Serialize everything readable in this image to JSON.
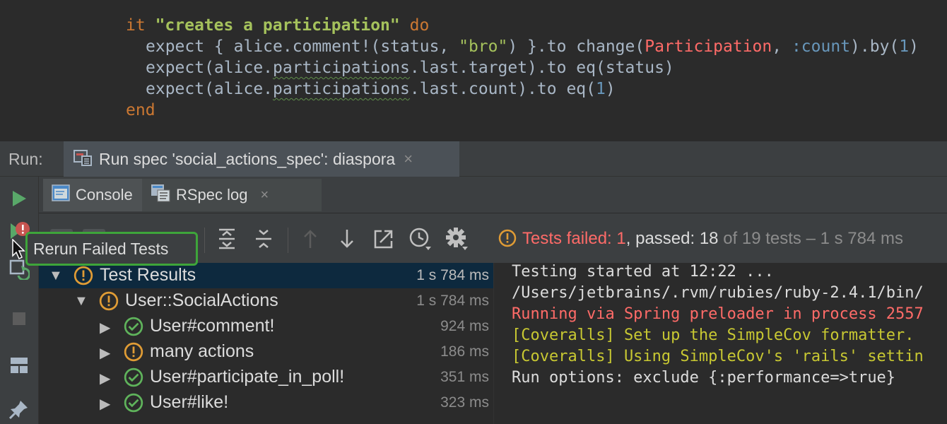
{
  "editor": {
    "line1": {
      "kw_it": "it",
      "string": "\"creates a participation\"",
      "kw_do": "do"
    },
    "line2": {
      "a": "expect { alice.comment!(status, ",
      "str": "\"bro\"",
      "b": ") }.to change(",
      "cls": "Participation",
      "comma": ", ",
      "sym": ":count",
      "c": ").by(",
      "num": "1",
      "d": ")"
    },
    "line3": {
      "a": "expect(alice.",
      "wavy": "participations",
      "b": ".last.target).to eq(status)"
    },
    "line4": {
      "a": "expect(alice.",
      "wavy": "participations",
      "b": ".last.count).to eq(",
      "num": "1",
      "c": ")"
    },
    "line5": {
      "kw_end": "end"
    }
  },
  "run_window": {
    "label": "Run:",
    "tab_label": "Run spec 'social_actions_spec': diaspora",
    "tab_close": "×"
  },
  "sub_tabs": {
    "console": "Console",
    "rspec_log": "RSpec log",
    "close": "×"
  },
  "status": {
    "failed_text": "Tests failed: ",
    "failed_count": "1",
    "passed_text": ", passed: ",
    "passed_count": "18",
    "of_text": " of 19 tests – 1 s 784 ms"
  },
  "tree": {
    "rows": [
      {
        "name": "Test Results",
        "time": "1 s 784 ms",
        "status": "warning"
      },
      {
        "name": "User::SocialActions",
        "time": "1 s 784 ms",
        "status": "warning"
      },
      {
        "name": "User#comment!",
        "time": "924 ms",
        "status": "passed"
      },
      {
        "name": "many actions",
        "time": "186 ms",
        "status": "warning"
      },
      {
        "name": "User#participate_in_poll!",
        "time": "351 ms",
        "status": "passed"
      },
      {
        "name": "User#like!",
        "time": "323 ms",
        "status": "passed"
      }
    ]
  },
  "console": {
    "lines": [
      {
        "text": "Testing started at 12:22 ...",
        "color": "#dcdcdc"
      },
      {
        "text": "/Users/jetbrains/.rvm/rubies/ruby-2.4.1/bin/",
        "color": "#dcdcdc"
      },
      {
        "text": "Running via Spring preloader in process 2557",
        "color": "#ff6b68"
      },
      {
        "text": "[Coveralls] Set up the SimpleCov formatter.",
        "color": "#c8c832"
      },
      {
        "text": "[Coveralls] Using SimpleCov's 'rails' settin",
        "color": "#c8c832"
      },
      {
        "text": "Run options: exclude {:performance=>true}",
        "color": "#dcdcdc"
      }
    ]
  },
  "tooltip": {
    "text": "Rerun Failed Tests"
  },
  "colors": {
    "accent_green": "#3ea53a",
    "fail_red": "#ff6b68",
    "warning_orange": "#e09c35",
    "passed_green": "#5fb35b",
    "selection": "#0d293e"
  },
  "icons": [
    "run-icon",
    "rerun-failed-icon",
    "toggle-auto-test-icon",
    "stop-icon",
    "layout-icon",
    "pin-icon",
    "expand-all-icon",
    "collapse-all-icon",
    "previous-failed-icon",
    "next-failed-icon",
    "export-icon",
    "history-icon",
    "settings-icon",
    "warning-icon",
    "passed-icon"
  ]
}
